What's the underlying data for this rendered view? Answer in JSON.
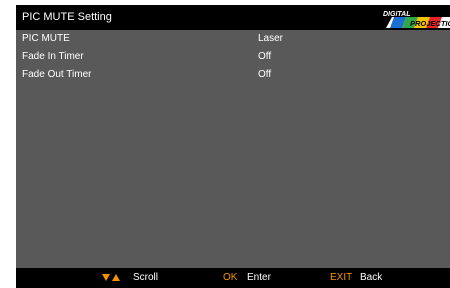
{
  "title": "PIC MUTE Setting",
  "logo": {
    "line1": "DIGITAL",
    "line2": "PROJECTION"
  },
  "rows": [
    {
      "label": "PIC MUTE",
      "value": "Laser"
    },
    {
      "label": "Fade In Timer",
      "value": "Off"
    },
    {
      "label": "Fade Out Timer",
      "value": "Off"
    }
  ],
  "footer": {
    "scroll_label": "Scroll",
    "ok_key": "OK",
    "ok_label": "Enter",
    "exit_key": "EXIT",
    "exit_label": "Back"
  },
  "colors": {
    "panel": "#595959",
    "bar": "#000000",
    "accent": "#f39200",
    "text": "#ffffff"
  },
  "icons": {
    "scroll": [
      "triangle-down-icon",
      "triangle-up-icon"
    ]
  }
}
